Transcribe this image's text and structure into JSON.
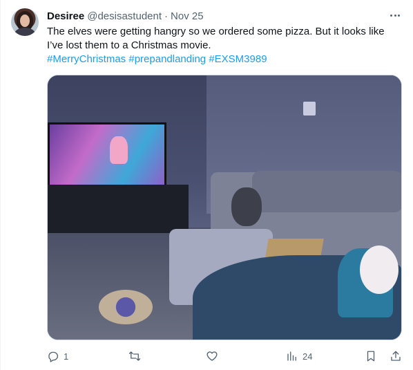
{
  "tweet": {
    "author_name": "Desiree",
    "author_handle": "@desisastudent",
    "separator": "·",
    "date": "Nov 25",
    "text": "The elves were getting hangry so we ordered some pizza. But it looks like I’ve lost them to a Christmas movie.",
    "hashtags": [
      "#MerryChristmas",
      "#prepandlanding",
      "#EXSM3989"
    ]
  },
  "actions": {
    "reply_count": "1",
    "retweet_count": "",
    "like_count": "",
    "views_count": "24"
  },
  "icons": {
    "more": "more-horizontal-icon",
    "reply": "reply-icon",
    "retweet": "retweet-icon",
    "like": "heart-icon",
    "views": "analytics-icon",
    "bookmark": "bookmark-icon",
    "share": "share-icon"
  },
  "colors": {
    "link": "#1d9bf0",
    "secondary_text": "#536471",
    "primary_text": "#0f1419"
  }
}
